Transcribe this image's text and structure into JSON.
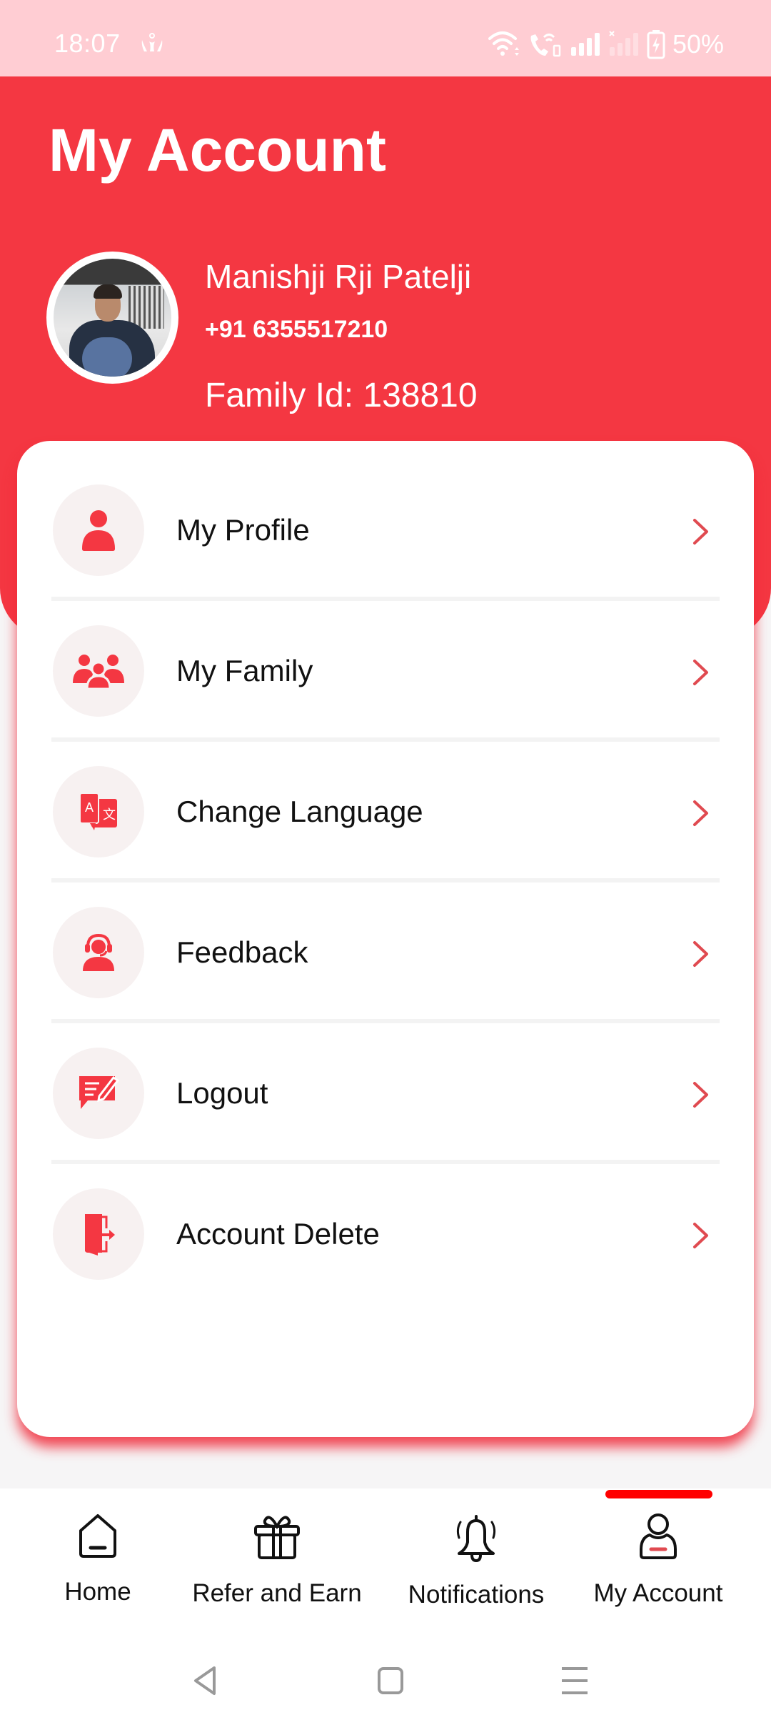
{
  "status_bar": {
    "time": "18:07",
    "app_notification_icon": "family-app-icon",
    "icons": [
      "wifi-icon",
      "wifi-calling-icon",
      "signal-icon",
      "no-signal-icon",
      "battery-charging-icon"
    ],
    "battery_percent": "50%"
  },
  "colors": {
    "brand": "#f43742",
    "status_bar_bg": "#ffcdd3",
    "icon_circle_bg": "#f7f1f1",
    "chevron": "#e04a50",
    "active_indicator": "#ff0000"
  },
  "header": {
    "title": "My Account"
  },
  "user": {
    "avatar": "user-photo",
    "name": "Manishji Rji Patelji",
    "phone": "+91 6355517210",
    "family_id": "Family Id: 138810"
  },
  "menu": {
    "items": [
      {
        "label": "My Profile",
        "icon": "person-icon"
      },
      {
        "label": "My Family",
        "icon": "family-group-icon"
      },
      {
        "label": "Change Language",
        "icon": "translate-icon"
      },
      {
        "label": "Feedback",
        "icon": "support-agent-icon"
      },
      {
        "label": "Logout",
        "icon": "edit-message-icon"
      },
      {
        "label": "Account Delete",
        "icon": "exit-door-icon"
      }
    ]
  },
  "bottom_nav": {
    "active": "My Account",
    "items": [
      {
        "label": "Home",
        "icon": "home-icon"
      },
      {
        "label": "Refer and Earn",
        "icon": "gift-icon"
      },
      {
        "label": "Notifications",
        "icon": "bell-icon"
      },
      {
        "label": "My Account",
        "icon": "account-icon"
      }
    ]
  },
  "system_nav": {
    "buttons": [
      "back",
      "home",
      "recents"
    ]
  }
}
